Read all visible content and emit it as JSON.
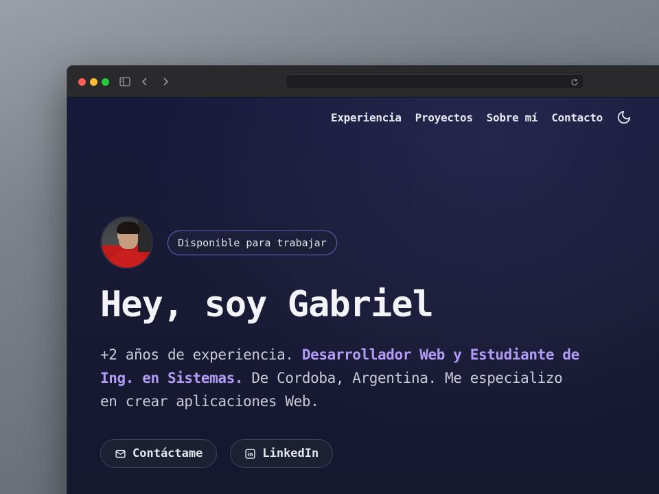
{
  "nav": {
    "items": [
      "Experiencia",
      "Proyectos",
      "Sobre mí",
      "Contacto"
    ],
    "theme_icon": "moon-icon"
  },
  "hero": {
    "badge": "Disponible para trabajar",
    "title": "Hey, soy Gabriel",
    "desc_part1": "+2 años de experiencia. ",
    "desc_highlight": "Desarrollador Web y Estudiante de Ing. en Sistemas.",
    "desc_part2": " De Cordoba, Argentina. Me especializo en crear aplicaciones Web.",
    "buttons": {
      "contact_label": "Contáctame",
      "linkedin_label": "LinkedIn"
    }
  },
  "colors": {
    "accent": "#b39cf5",
    "badge_border": "#6c56b8",
    "background": "#17193a"
  }
}
